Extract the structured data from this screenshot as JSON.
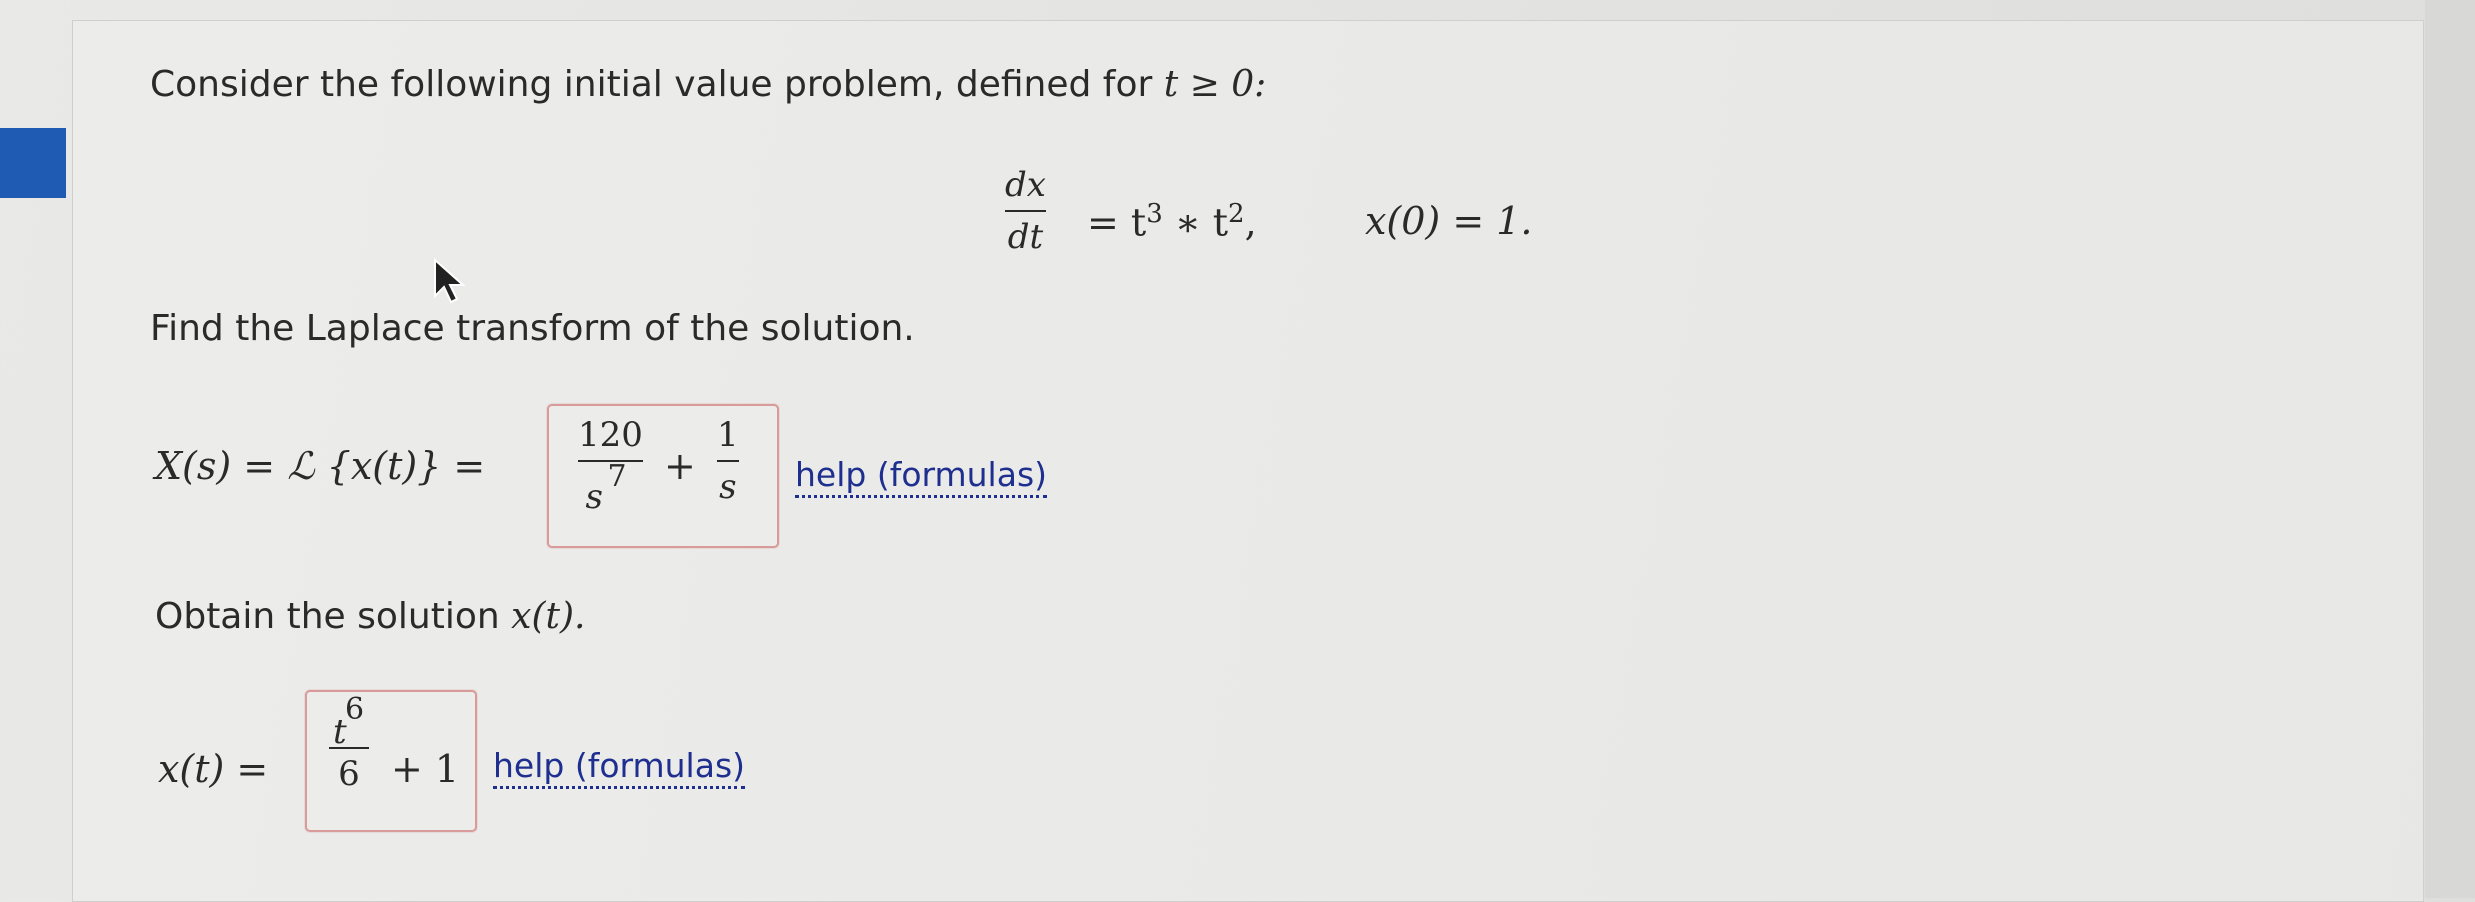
{
  "problem": {
    "intro": "Consider the following initial value problem, defined for",
    "condition": "t ≥ 0:",
    "ode_lhs_num": "dx",
    "ode_lhs_den": "dt",
    "ode_rhs_prefix": "= t",
    "ode_rhs_exp1": "3",
    "ode_rhs_mid": " ∗ t",
    "ode_rhs_exp2": "2",
    "ode_rhs_suffix": ",",
    "initial_condition": "x(0) = 1."
  },
  "part1": {
    "prompt": "Find the Laplace transform of the solution.",
    "lhs": "X(s) = ℒ {x(t)} =",
    "answer_frac1_num": "120",
    "answer_frac1_den_base": "s",
    "answer_frac1_den_exp": "7",
    "answer_plus": "+",
    "answer_frac2_num": "1",
    "answer_frac2_den": "s",
    "help_label": "help (formulas)"
  },
  "part2": {
    "prompt_prefix": "Obtain the solution",
    "prompt_math": "x(t).",
    "lhs": "x(t) =",
    "answer_num_base": "t",
    "answer_num_exp": "6",
    "answer_den": "6",
    "answer_tail": "+ 1",
    "help_label": "help (formulas)"
  },
  "colors": {
    "link": "#1f2f8f",
    "answer_border": "#d99a9a",
    "side_tab": "#1f5bb3"
  },
  "icons": [
    "mouse-pointer-icon"
  ]
}
